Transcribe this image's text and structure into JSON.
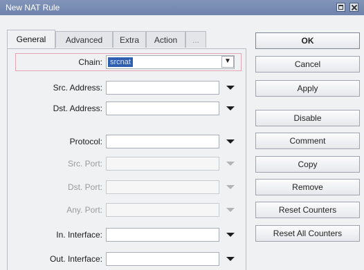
{
  "window": {
    "title": "New NAT Rule",
    "restore_icon": "restore-icon",
    "close_icon": "close-icon"
  },
  "tabs": [
    {
      "label": "General",
      "active": true
    },
    {
      "label": "Advanced",
      "active": false
    },
    {
      "label": "Extra",
      "active": false
    },
    {
      "label": "Action",
      "active": false
    },
    {
      "label": "...",
      "active": false
    }
  ],
  "form": {
    "chain": {
      "label": "Chain:",
      "value": "srcnat"
    },
    "src_address": {
      "label": "Src. Address:",
      "value": ""
    },
    "dst_address": {
      "label": "Dst. Address:",
      "value": ""
    },
    "protocol": {
      "label": "Protocol:",
      "value": ""
    },
    "src_port": {
      "label": "Src. Port:",
      "value": ""
    },
    "dst_port": {
      "label": "Dst. Port:",
      "value": ""
    },
    "any_port": {
      "label": "Any. Port:",
      "value": ""
    },
    "in_interface": {
      "label": "In. Interface:",
      "value": ""
    },
    "out_interface": {
      "label": "Out. Interface:",
      "value": ""
    }
  },
  "buttons": {
    "ok": "OK",
    "cancel": "Cancel",
    "apply": "Apply",
    "disable": "Disable",
    "comment": "Comment",
    "copy": "Copy",
    "remove": "Remove",
    "reset_counters": "Reset Counters",
    "reset_all_counters": "Reset All Counters"
  },
  "colors": {
    "titlebar": "#7385ae",
    "selection": "#2f5fb0",
    "highlight_border": "#e3a4b3"
  }
}
